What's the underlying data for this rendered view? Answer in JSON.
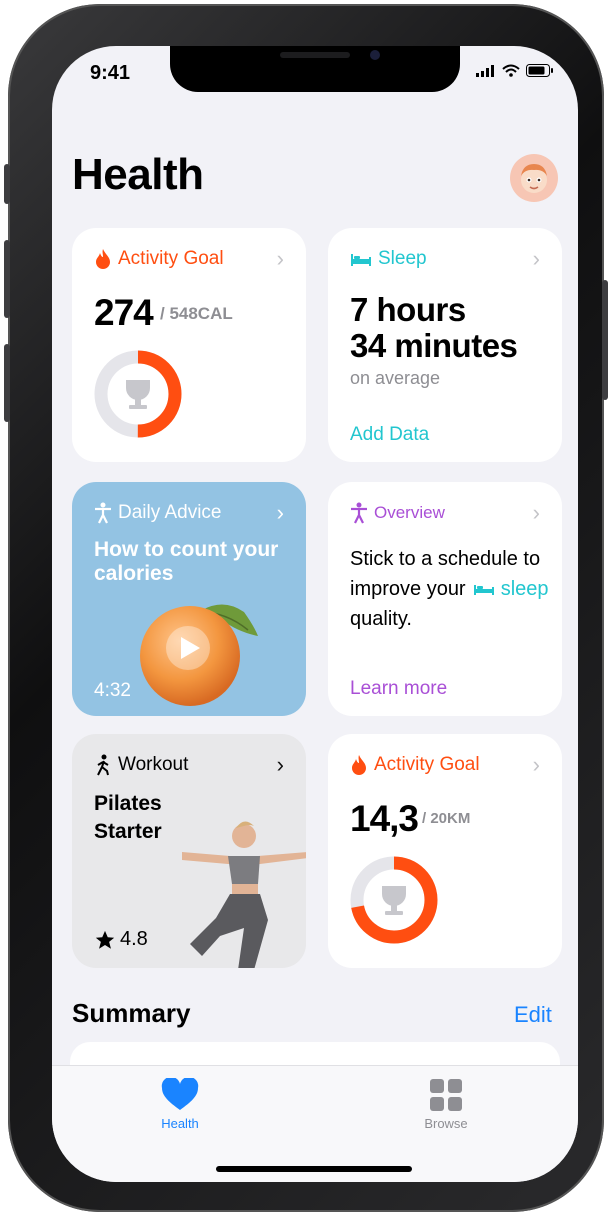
{
  "status": {
    "time": "9:41"
  },
  "header": {
    "title": "Health"
  },
  "cards": {
    "activity1": {
      "title": "Activity Goal",
      "value": "274",
      "unit": "/ 548CAL",
      "progress": 0.5
    },
    "sleep": {
      "title": "Sleep",
      "line1": "7 hours",
      "line2": "34 minutes",
      "sub": "on average",
      "link": "Add Data"
    },
    "advice": {
      "title": "Daily Advice",
      "headline": "How to count your calories",
      "duration": "4:32"
    },
    "overview": {
      "title": "Overview",
      "text1": "Stick to a schedule to improve your",
      "text_sleep": "sleep",
      "text2": "quality.",
      "link": "Learn more"
    },
    "workout": {
      "title": "Workout",
      "name": "Pilates Starter",
      "rating": "4.8"
    },
    "activity2": {
      "title": "Activity Goal",
      "value": "14,3",
      "unit": "/ 20KM",
      "progress": 0.72
    }
  },
  "summary": {
    "title": "Summary",
    "edit": "Edit"
  },
  "tabs": [
    {
      "label": "Health",
      "icon": "heart-icon",
      "active": true
    },
    {
      "label": "Browse",
      "icon": "grid-icon",
      "active": false
    }
  ],
  "colors": {
    "accent": "#1a84ff",
    "orange": "#ff4e11",
    "teal": "#22c6cf",
    "purple": "#a94fd6",
    "advice_bg": "#93c3e3"
  }
}
